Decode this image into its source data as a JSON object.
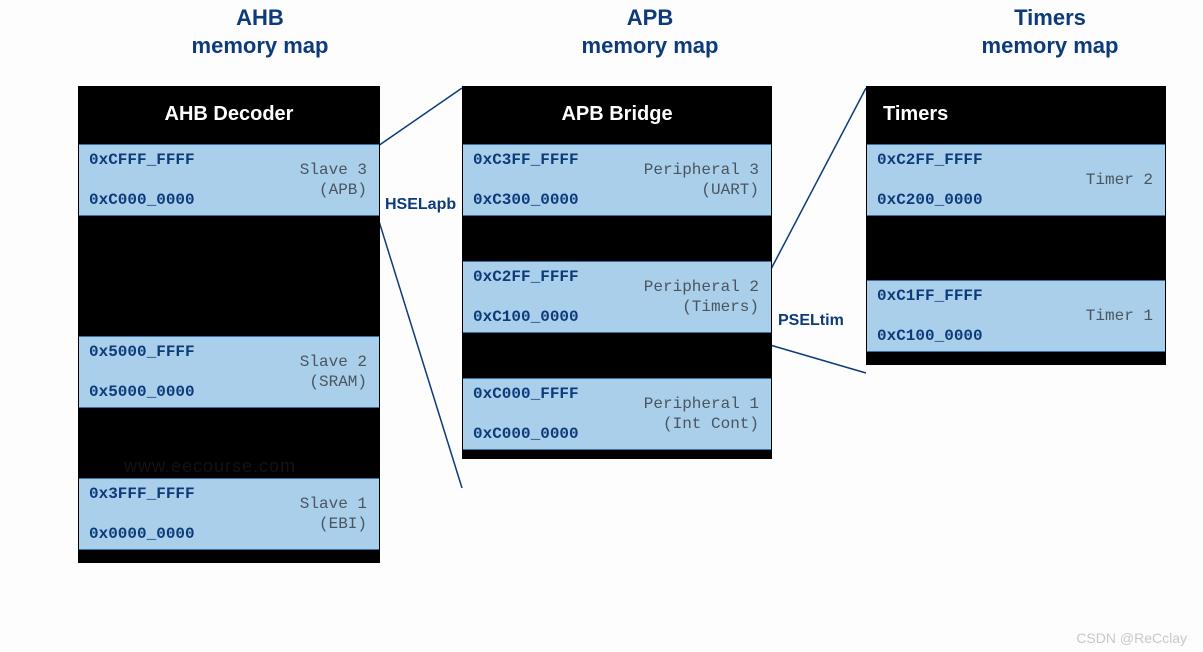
{
  "titles": {
    "ahb_line1": "AHB",
    "ahb_line2": "memory map",
    "apb_line1": "APB",
    "apb_line2": "memory map",
    "tim_line1": "Timers",
    "tim_line2": "memory map"
  },
  "headers": {
    "ahb": "AHB Decoder",
    "apb": "APB Bridge",
    "tim": "Timers"
  },
  "ahb": {
    "slave3": {
      "hi": "0xCFFF_FFFF",
      "lo": "0xC000_0000",
      "name": "Slave 3",
      "sub": "(APB)"
    },
    "slave2": {
      "hi": "0x5000_FFFF",
      "lo": "0x5000_0000",
      "name": "Slave 2",
      "sub": "(SRAM)"
    },
    "slave1": {
      "hi": "0x3FFF_FFFF",
      "lo": "0x0000_0000",
      "name": "Slave 1",
      "sub": "(EBI)"
    }
  },
  "apb": {
    "p3": {
      "hi": "0xC3FF_FFFF",
      "lo": "0xC300_0000",
      "name": "Peripheral 3",
      "sub": "(UART)"
    },
    "p2": {
      "hi": "0xC2FF_FFFF",
      "lo": "0xC100_0000",
      "name": "Peripheral 2",
      "sub": "(Timers)"
    },
    "p1": {
      "hi": "0xC000_FFFF",
      "lo": "0xC000_0000",
      "name": "Peripheral 1",
      "sub": "(Int Cont)"
    }
  },
  "tim": {
    "t2": {
      "hi": "0xC2FF_FFFF",
      "lo": "0xC200_0000",
      "name": "Timer 2"
    },
    "t1": {
      "hi": "0xC1FF_FFFF",
      "lo": "0xC100_0000",
      "name": "Timer 1"
    }
  },
  "signals": {
    "hsel": "HSELapb",
    "psel": "PSELtim"
  },
  "faint_url": "www.eecourse.com",
  "watermark": "CSDN @ReCclay"
}
